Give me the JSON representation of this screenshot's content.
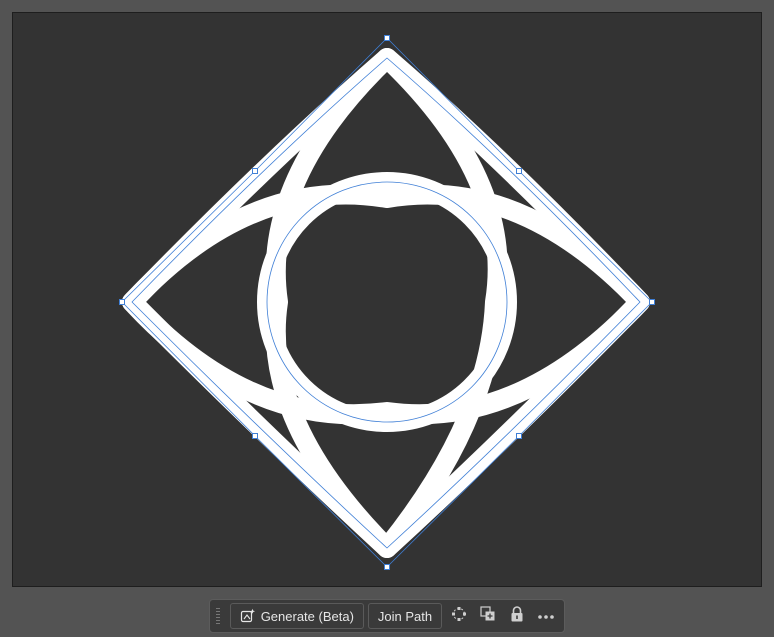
{
  "canvas": {
    "background": "#535353",
    "artboard_color": "#333333",
    "stroke_color": "#ffffff",
    "path_outline_color": "#3f7fd6"
  },
  "context_bar": {
    "generate_label": "Generate (Beta)",
    "join_path_label": "Join Path",
    "icons": [
      "generate-icon",
      "path-anchors-icon",
      "arrange-icon",
      "lock-icon",
      "more-options-icon"
    ]
  }
}
